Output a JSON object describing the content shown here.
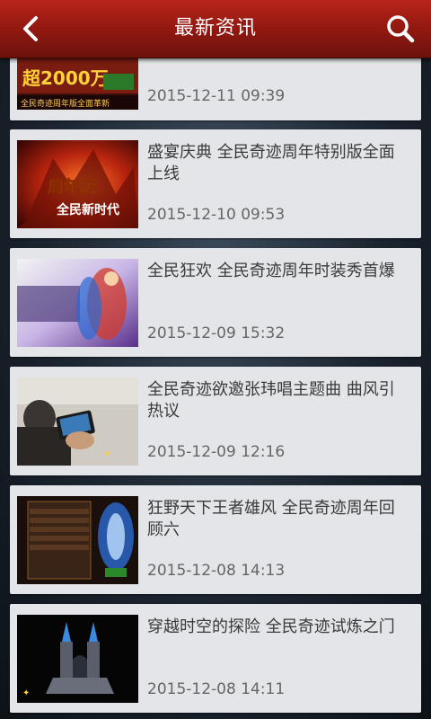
{
  "header": {
    "title": "最新资讯"
  },
  "news": [
    {
      "title": "",
      "date": "2015-12-11 09:39",
      "thumb_text": "超2000万",
      "thumb_sub": "全民奇迹周年版全面革新"
    },
    {
      "title": "盛宴庆典 全民奇迹周年特别版全面上线",
      "date": "2015-12-10 09:53",
      "thumb_text": "周年庆",
      "thumb_sub": "全民新时代"
    },
    {
      "title": "全民狂欢 全民奇迹周年时装秀首爆",
      "date": "2015-12-09 15:32",
      "thumb_text": ""
    },
    {
      "title": "全民奇迹欲邀张玮唱主题曲 曲风引热议",
      "date": "2015-12-09 12:16",
      "thumb_text": ""
    },
    {
      "title": "狂野天下王者雄风 全民奇迹周年回顾六",
      "date": "2015-12-08 14:13",
      "thumb_text": ""
    },
    {
      "title": "穿越时空的探险 全民奇迹试炼之门",
      "date": "2015-12-08 14:11",
      "thumb_text": ""
    }
  ]
}
